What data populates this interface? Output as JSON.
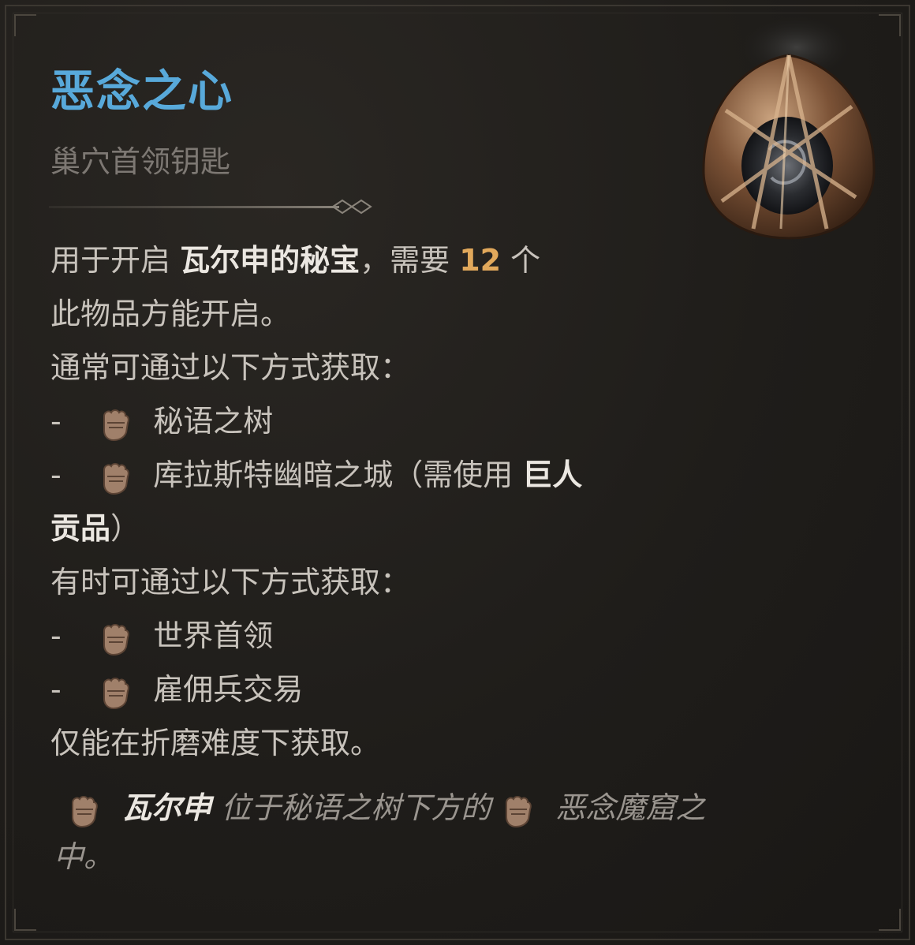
{
  "item": {
    "name": "恶念之心",
    "type": "巢穴首领钥匙",
    "icon": "heart-of-malice-orb-icon"
  },
  "description": {
    "use_pre": "用于开启 ",
    "use_target": "瓦尔申的秘宝",
    "use_mid": "，需要 ",
    "use_count": "12",
    "use_post": " 个",
    "use_line2": "此物品方能开启。",
    "common_header": "通常可通过以下方式获取：",
    "common_sources": [
      {
        "dash": "-",
        "label_pre": "秘语之树",
        "label_bold": "",
        "label_post": ""
      },
      {
        "dash": "-",
        "label_pre": "库拉斯特幽暗之城（需使用 ",
        "label_bold": "巨人",
        "label_post": ""
      }
    ],
    "common_wrap_bold": "贡品",
    "common_wrap_post": "）",
    "rare_header": "有时可通过以下方式获取：",
    "rare_sources": [
      {
        "dash": "-",
        "label": "世界首领"
      },
      {
        "dash": "-",
        "label": "雇佣兵交易"
      }
    ],
    "restriction": "仅能在折磨难度下获取。"
  },
  "location_note": {
    "boss": "瓦尔申",
    "text_mid": " 位于秘语之树下方的 ",
    "text_end": "恶念魔窟之",
    "text_wrap": "中。"
  },
  "icons": {
    "source_marker": "fist-icon",
    "divider": "diamond-divider-icon"
  },
  "colors": {
    "title": "#58a9da",
    "count": "#e1a85b",
    "body": "#c8c3bc",
    "subtitle": "#7d7873"
  }
}
